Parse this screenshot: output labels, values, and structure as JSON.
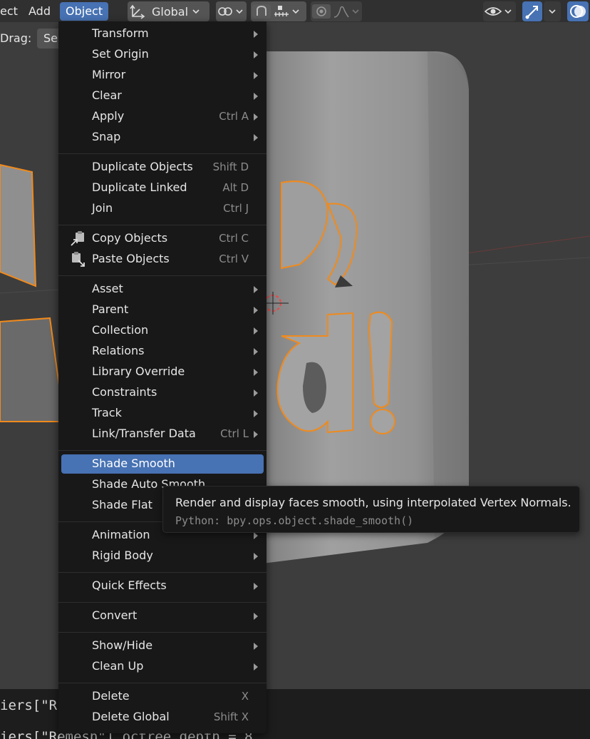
{
  "header": {
    "menus": [
      {
        "label": "ect"
      },
      {
        "label": "Add"
      },
      {
        "label": "Object"
      }
    ],
    "transform_orientation": "Global"
  },
  "tool_settings": {
    "drag_label": "Drag:",
    "drag_value": "Se"
  },
  "viewport": {
    "text_3d_line1": "Hello,",
    "text_3d_line2": "World!",
    "object_color": "#9a9a9a",
    "selection_outline_color": "#f08a1c"
  },
  "menu": {
    "items": [
      {
        "label": "Transform",
        "shortcut": "",
        "submenu": true
      },
      {
        "label": "Set Origin",
        "shortcut": "",
        "submenu": true
      },
      {
        "label": "Mirror",
        "shortcut": "",
        "submenu": true
      },
      {
        "label": "Clear",
        "shortcut": "",
        "submenu": true
      },
      {
        "label": "Apply",
        "shortcut": "Ctrl A",
        "submenu": true
      },
      {
        "label": "Snap",
        "shortcut": "",
        "submenu": true
      },
      {
        "label": "Duplicate Objects",
        "shortcut": "Shift D",
        "submenu": false
      },
      {
        "label": "Duplicate Linked",
        "shortcut": "Alt D",
        "submenu": false
      },
      {
        "label": "Join",
        "shortcut": "Ctrl J",
        "submenu": false
      },
      {
        "label": "Copy Objects",
        "shortcut": "Ctrl C",
        "submenu": false,
        "icon": "copy-icon"
      },
      {
        "label": "Paste Objects",
        "shortcut": "Ctrl V",
        "submenu": false,
        "icon": "paste-icon"
      },
      {
        "label": "Asset",
        "shortcut": "",
        "submenu": true
      },
      {
        "label": "Parent",
        "shortcut": "",
        "submenu": true
      },
      {
        "label": "Collection",
        "shortcut": "",
        "submenu": true
      },
      {
        "label": "Relations",
        "shortcut": "",
        "submenu": true
      },
      {
        "label": "Library Override",
        "shortcut": "",
        "submenu": true
      },
      {
        "label": "Constraints",
        "shortcut": "",
        "submenu": true
      },
      {
        "label": "Track",
        "shortcut": "",
        "submenu": true
      },
      {
        "label": "Link/Transfer Data",
        "shortcut": "Ctrl L",
        "submenu": true
      },
      {
        "label": "Shade Smooth",
        "shortcut": "",
        "submenu": false,
        "highlighted": true
      },
      {
        "label": "Shade Auto Smooth",
        "shortcut": "",
        "submenu": false
      },
      {
        "label": "Shade Flat",
        "shortcut": "",
        "submenu": false
      },
      {
        "label": "Animation",
        "shortcut": "",
        "submenu": true
      },
      {
        "label": "Rigid Body",
        "shortcut": "",
        "submenu": true
      },
      {
        "label": "Quick Effects",
        "shortcut": "",
        "submenu": true
      },
      {
        "label": "Convert",
        "shortcut": "",
        "submenu": true
      },
      {
        "label": "Show/Hide",
        "shortcut": "",
        "submenu": true
      },
      {
        "label": "Clean Up",
        "shortcut": "",
        "submenu": true
      },
      {
        "label": "Delete",
        "shortcut": "X",
        "submenu": false
      },
      {
        "label": "Delete Global",
        "shortcut": "Shift X",
        "submenu": false
      }
    ]
  },
  "tooltip": {
    "description": "Render and display faces smooth, using interpolated Vertex Normals.",
    "python": "Python: bpy.ops.object.shade_smooth()"
  },
  "console": {
    "line1": "iers[\"R",
    "line2": "iers[\"Remesh\"].octree_depth = 8"
  },
  "colors": {
    "accent": "#4772b3",
    "menu_bg": "#181818",
    "header_bg": "#303030",
    "viewport_bg": "#3d3d3d"
  }
}
